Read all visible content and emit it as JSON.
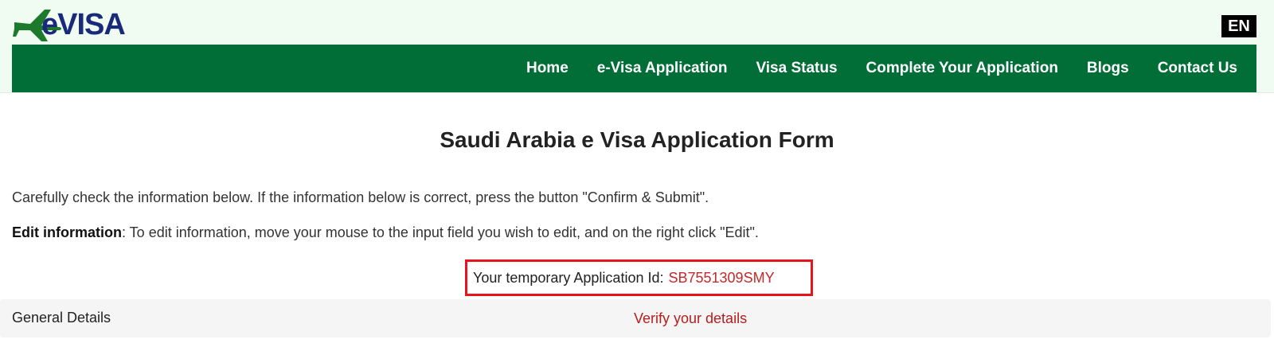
{
  "header": {
    "logo_text": "eVISA",
    "logo_icon": "airplane-icon",
    "language": "EN"
  },
  "nav": {
    "items": [
      {
        "label": "Home"
      },
      {
        "label": "e-Visa Application"
      },
      {
        "label": "Visa Status"
      },
      {
        "label": "Complete Your Application"
      },
      {
        "label": "Blogs"
      },
      {
        "label": "Contact Us"
      }
    ]
  },
  "main": {
    "title": "Saudi Arabia e Visa Application Form",
    "instruction": "Carefully check the information below. If the information below is correct, press the button \"Confirm & Submit\".",
    "edit_label": "Edit information",
    "edit_text": ": To edit information, move your mouse to the input field you wish to edit, and on the right click \"Edit\".",
    "application_id_label": "Your temporary Application Id:",
    "application_id_value": "SB7551309SMY",
    "section_title": "General Details",
    "section_note": "Verify your details"
  },
  "colors": {
    "nav_bg": "#016d37",
    "header_bg": "#f0fcf2",
    "highlight_border": "#e8141b",
    "id_value": "#c62828"
  }
}
